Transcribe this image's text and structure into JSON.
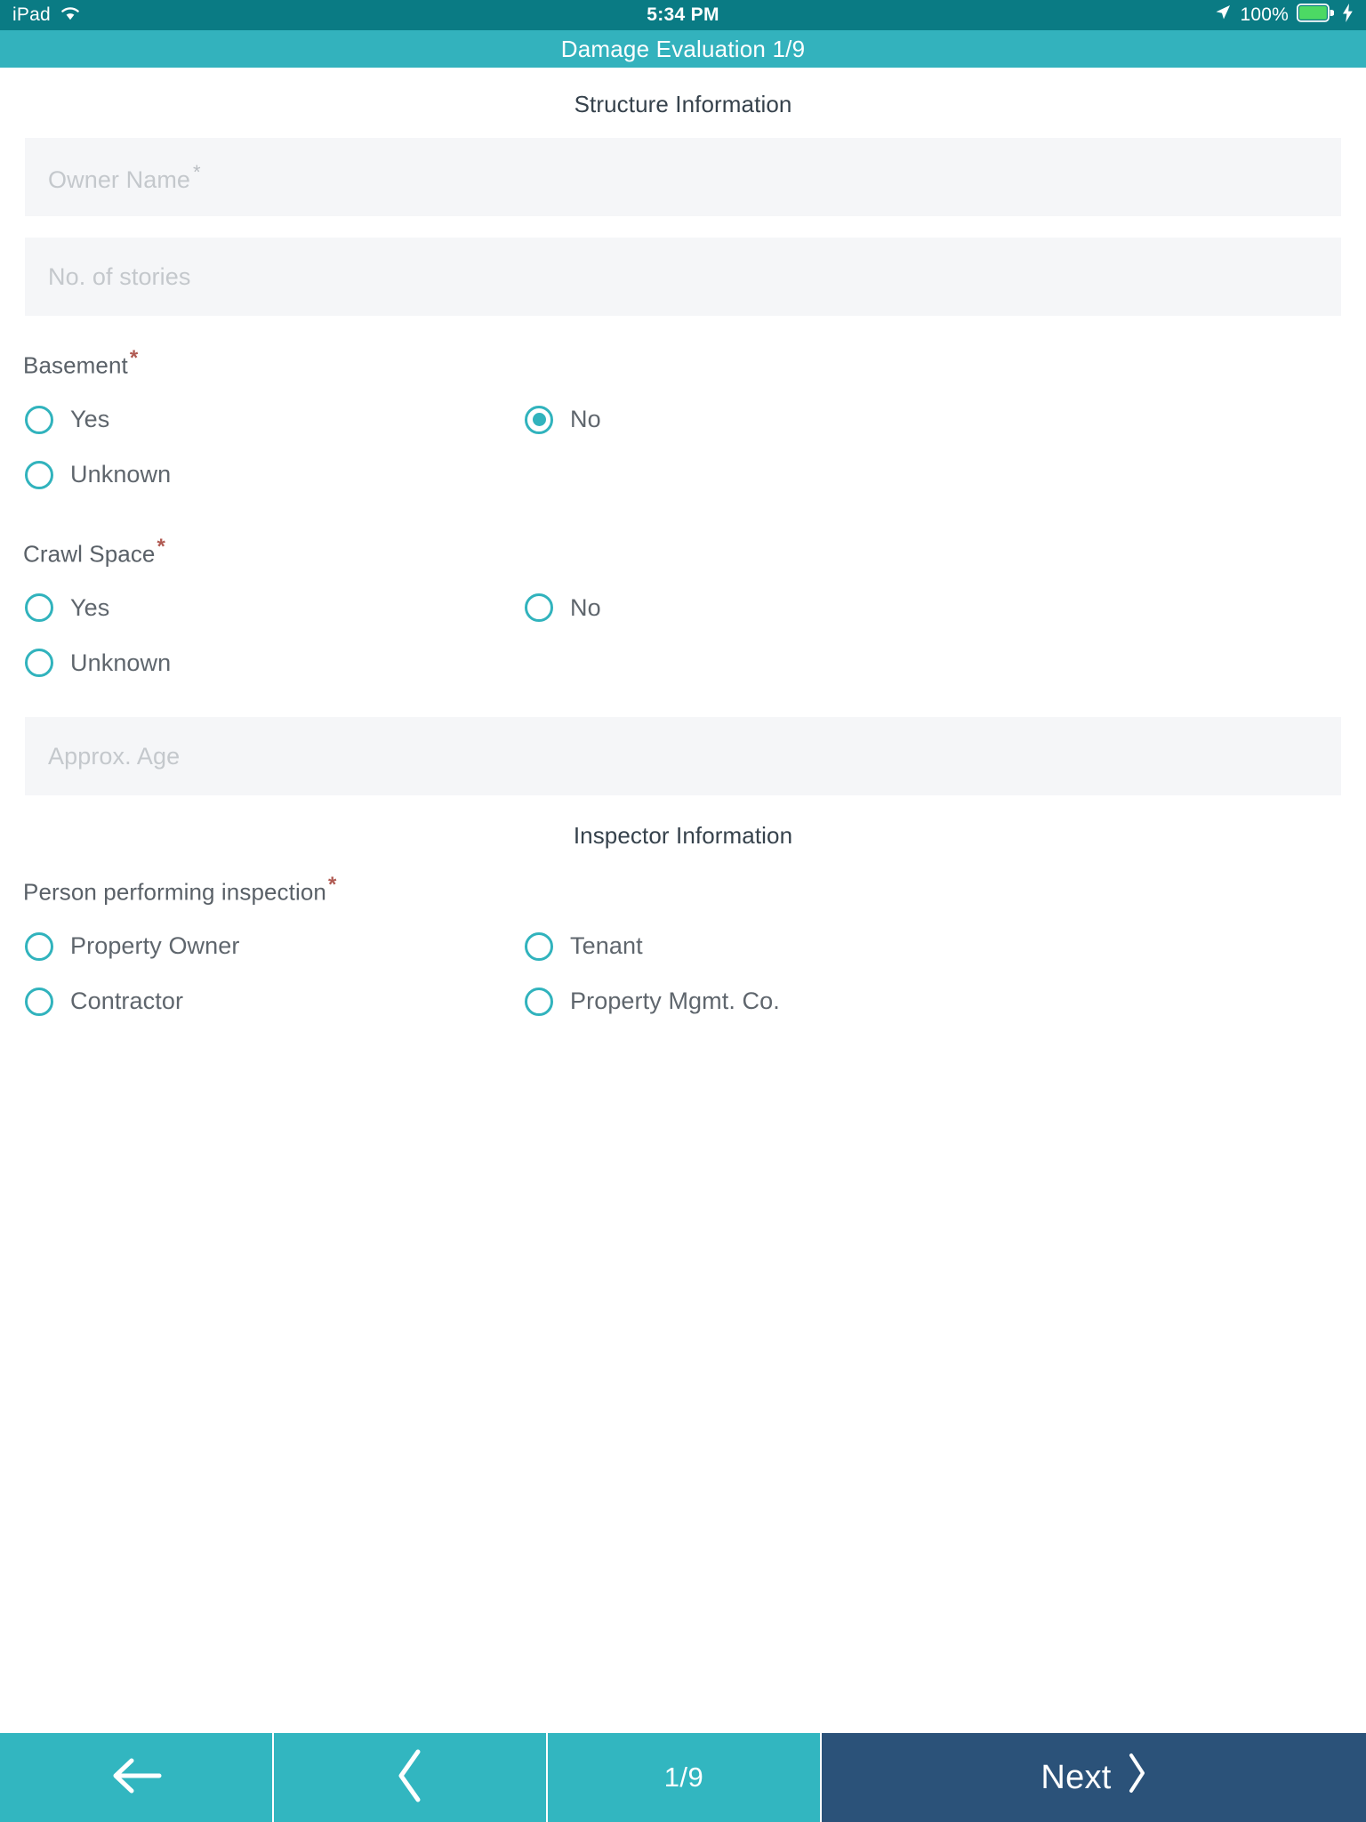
{
  "status_bar": {
    "device_name": "iPad",
    "wifi_icon": "wifi-icon",
    "time": "5:34 PM",
    "location_icon": "location-arrow-icon",
    "battery_percent": "100%",
    "battery_icon": "battery-full-icon",
    "charging_icon": "lightning-bolt-icon",
    "background": "#0a7b84"
  },
  "title_bar": {
    "title": "Damage Evaluation 1/9",
    "background": "#33b2bd"
  },
  "form": {
    "structure_section": {
      "heading": "Structure Information",
      "owner_name": {
        "placeholder": "Owner Name",
        "required_marker": "*",
        "value": ""
      },
      "stories": {
        "placeholder": "No. of stories",
        "required_marker": "",
        "value": ""
      },
      "basement": {
        "label": "Basement",
        "required_marker": "*",
        "options": [
          {
            "label": "Yes",
            "selected": false
          },
          {
            "label": "No",
            "selected": true
          },
          {
            "label": "Unknown",
            "selected": false
          }
        ]
      },
      "crawl_space": {
        "label": "Crawl Space",
        "required_marker": "*",
        "options": [
          {
            "label": "Yes",
            "selected": false
          },
          {
            "label": "No",
            "selected": false
          },
          {
            "label": "Unknown",
            "selected": false
          }
        ]
      },
      "approx_age": {
        "placeholder": "Approx. Age",
        "required_marker": "",
        "value": ""
      }
    },
    "inspector_section": {
      "heading": "Inspector Information",
      "person_performing": {
        "label": "Person performing inspection",
        "required_marker": "*",
        "options": [
          {
            "label": "Property Owner",
            "selected": false
          },
          {
            "label": "Tenant",
            "selected": false
          },
          {
            "label": "Contractor",
            "selected": false
          },
          {
            "label": "Property Mgmt. Co.",
            "selected": false
          }
        ]
      }
    }
  },
  "toolbar": {
    "back_icon": "arrow-left-icon",
    "prev_icon": "chevron-left-icon",
    "page_counter": "1/9",
    "next_label": "Next",
    "next_icon": "chevron-right-icon",
    "teal": "#32b6c0",
    "next_background": "#2b5279"
  },
  "colors": {
    "accent_teal": "#31b3bd",
    "status_dark_teal": "#0a7b84",
    "required_red": "#b05a52",
    "field_background": "#f5f6f8",
    "heading_text": "#36424c",
    "body_text": "#5f666d",
    "placeholder_text": "#c4c8cc"
  }
}
